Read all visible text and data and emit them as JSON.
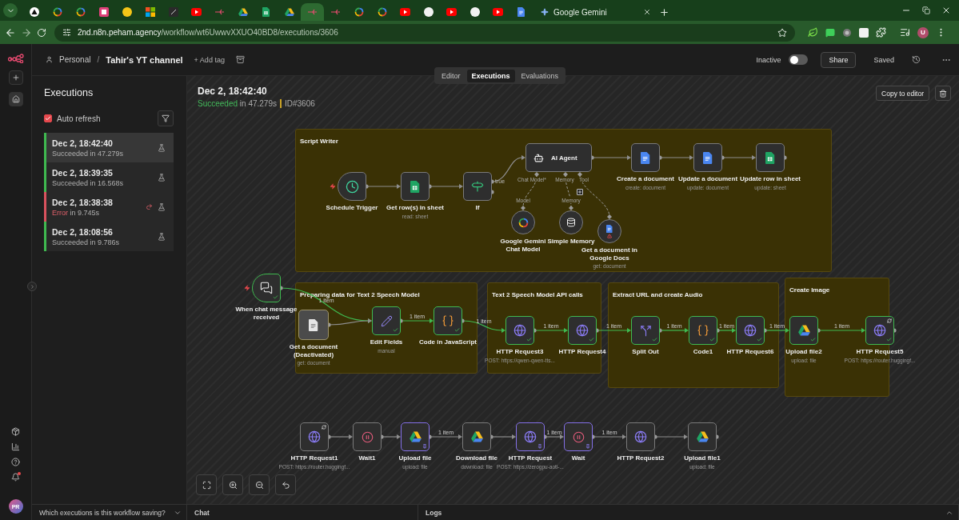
{
  "browser": {
    "tabs": [
      {
        "selected": false
      },
      {
        "selected": false
      },
      {
        "selected": false
      },
      {
        "selected": false
      },
      {
        "selected": false
      },
      {
        "selected": false
      },
      {
        "selected": false
      },
      {
        "selected": false
      },
      {
        "selected": false
      },
      {
        "selected": false
      },
      {
        "selected": false
      },
      {
        "selected": false
      },
      {
        "selected": true
      },
      {
        "selected": false
      },
      {
        "selected": false
      },
      {
        "selected": false
      },
      {
        "selected": false
      },
      {
        "selected": false
      },
      {
        "selected": false
      },
      {
        "selected": false
      },
      {
        "selected": false
      },
      {
        "selected": false
      },
      {
        "label": "Google Gemini",
        "selected": false
      }
    ],
    "url_host": "2nd.n8n.peham.agency",
    "url_path": "/workflow/wt6UwwvXXUO40BD8/executions/3606",
    "profile_initial": "U"
  },
  "rail": {
    "avatar_initials": "PR"
  },
  "header": {
    "project": "Personal",
    "separator": "/",
    "workflow": "Tahir's YT channel",
    "add_tag": "+ Add tag",
    "active_label": "Inactive",
    "active": false,
    "share": "Share",
    "save_status": "Saved"
  },
  "view_tabs": [
    {
      "label": "Editor",
      "selected": false
    },
    {
      "label": "Executions",
      "selected": true
    },
    {
      "label": "Evaluations",
      "selected": false
    }
  ],
  "executions": {
    "title": "Executions",
    "auto_refresh": {
      "label": "Auto refresh",
      "checked": true
    },
    "items": [
      {
        "time": "Dec 2, 18:42:40",
        "status": "Succeeded",
        "kind": "success",
        "duration": "in 47.279s",
        "selected": true
      },
      {
        "time": "Dec 2, 18:39:35",
        "status": "Succeeded",
        "kind": "success",
        "duration": "in 16.568s",
        "selected": false
      },
      {
        "time": "Dec 2, 18:38:38",
        "status": "Error",
        "kind": "error",
        "duration": "in 9.745s",
        "selected": false
      },
      {
        "time": "Dec 2, 18:08:56",
        "status": "Succeeded",
        "kind": "success",
        "duration": "in 9.786s",
        "selected": false
      }
    ]
  },
  "detail": {
    "time": "Dec 2, 18:42:40",
    "status": "Succeeded",
    "kind": "success",
    "duration": "in 47.279s",
    "id": "ID#3606",
    "copy_button": "Copy to editor"
  },
  "canvas": {
    "groups": [
      {
        "title": "Script Writer"
      },
      {
        "title": "Preparing data for Text 2 Speech Model"
      },
      {
        "title": "Text 2 Speech Model API calls"
      },
      {
        "title": "Extract URL and create Audio"
      },
      {
        "title": "Create Image"
      }
    ],
    "nodes": [
      {
        "kind": "schedule",
        "label": "Schedule Trigger",
        "executed": false,
        "pinned": false,
        "disabled": false,
        "retry": false
      },
      {
        "kind": "sheets",
        "label": "Get row(s) in sheet",
        "subtitle": "read: sheet",
        "executed": false,
        "pinned": false,
        "disabled": false,
        "retry": false
      },
      {
        "kind": "if",
        "label": "If",
        "branch_label": "true",
        "executed": false,
        "pinned": false,
        "disabled": false,
        "retry": false
      },
      {
        "kind": "agent",
        "label": "AI Agent",
        "ports": [
          "Chat Model*",
          "Memory",
          "Tool"
        ],
        "executed": false,
        "pinned": false,
        "disabled": false,
        "retry": false
      },
      {
        "kind": "docs",
        "label": "Create a document",
        "subtitle": "create: document",
        "executed": false,
        "pinned": false,
        "disabled": false,
        "retry": false
      },
      {
        "kind": "docs",
        "label": "Update a document",
        "subtitle": "update: document",
        "executed": false,
        "pinned": false,
        "disabled": false,
        "retry": false
      },
      {
        "kind": "sheets",
        "label": "Update row in sheet",
        "subtitle": "update: sheet",
        "executed": false,
        "pinned": false,
        "disabled": false,
        "retry": false
      },
      {
        "kind": "gemini",
        "label": "Google Gemini Chat Model",
        "port": "Model",
        "executed": false,
        "pinned": false,
        "disabled": false,
        "retry": false
      },
      {
        "kind": "memory",
        "label": "Simple Memory",
        "port": "Memory",
        "executed": false,
        "pinned": false,
        "disabled": false,
        "retry": false
      },
      {
        "kind": "tool",
        "label": "Get a document in Google Docs",
        "subtitle": "get: document",
        "executed": false,
        "pinned": false,
        "disabled": false,
        "retry": false
      },
      {
        "kind": "chat",
        "label": "When chat message received",
        "output_label": "1 item",
        "executed": true,
        "pinned": false,
        "disabled": false,
        "retry": false
      },
      {
        "kind": "docs",
        "label": "Get a document (Deactivated)",
        "subtitle": "get: document",
        "executed": false,
        "pinned": false,
        "disabled": true,
        "retry": false
      },
      {
        "kind": "edit",
        "label": "Edit Fields",
        "subtitle": "manual",
        "output_label": "1 item",
        "executed": true,
        "pinned": false,
        "disabled": false,
        "retry": false
      },
      {
        "kind": "code",
        "label": "Code in JavaScript",
        "output_label": "1 item",
        "executed": true,
        "pinned": false,
        "disabled": false,
        "retry": false
      },
      {
        "kind": "http",
        "label": "HTTP Request3",
        "subtitle": "POST: https://qwen-qwen-tts...",
        "output_label": "1 item",
        "executed": true,
        "pinned": false,
        "disabled": false,
        "retry": false
      },
      {
        "kind": "http",
        "label": "HTTP Request4",
        "output_label": "1 item",
        "executed": true,
        "pinned": false,
        "disabled": false,
        "retry": false
      },
      {
        "kind": "split",
        "label": "Split Out",
        "output_label": "1 item",
        "executed": true,
        "pinned": false,
        "disabled": false,
        "retry": false
      },
      {
        "kind": "code",
        "label": "Code1",
        "output_label": "1 item",
        "executed": true,
        "pinned": false,
        "disabled": false,
        "retry": false
      },
      {
        "kind": "http",
        "label": "HTTP Request6",
        "output_label": "1 item",
        "executed": true,
        "pinned": false,
        "disabled": false,
        "retry": false
      },
      {
        "kind": "drive",
        "label": "Upload file2",
        "subtitle": "upload: file",
        "output_label": "1 item",
        "executed": true,
        "pinned": false,
        "disabled": false,
        "retry": false
      },
      {
        "kind": "http",
        "label": "HTTP Request5",
        "subtitle": "POST: https://router.huggingf...",
        "executed": true,
        "pinned": false,
        "disabled": false,
        "retry": true
      },
      {
        "kind": "http",
        "label": "HTTP Request1",
        "subtitle": "POST: https://router.huggingf...",
        "executed": false,
        "pinned": false,
        "disabled": false,
        "retry": true
      },
      {
        "kind": "wait",
        "label": "Wait1",
        "executed": false,
        "pinned": false,
        "disabled": false,
        "retry": false
      },
      {
        "kind": "drive",
        "label": "Upload file",
        "subtitle": "upload: file",
        "output_label": "1 item",
        "executed": false,
        "pinned": true,
        "disabled": false,
        "retry": false
      },
      {
        "kind": "drive",
        "label": "Download file",
        "subtitle": "download: file",
        "executed": false,
        "pinned": false,
        "disabled": false,
        "retry": false
      },
      {
        "kind": "http",
        "label": "HTTP Request",
        "subtitle": "POST: https://zerogpu-aoti-...",
        "output_label": "1 item",
        "executed": false,
        "pinned": true,
        "disabled": false,
        "retry": false
      },
      {
        "kind": "wait",
        "label": "Wait",
        "output_label": "1 item",
        "executed": false,
        "pinned": true,
        "disabled": false,
        "retry": false
      },
      {
        "kind": "http",
        "label": "HTTP Request2",
        "executed": false,
        "pinned": false,
        "disabled": false,
        "retry": false
      },
      {
        "kind": "drive",
        "label": "Upload file1",
        "subtitle": "upload: file",
        "executed": false,
        "pinned": false,
        "disabled": false,
        "retry": false
      }
    ]
  },
  "bottom_bar": {
    "saving_question": "Which executions is this workflow saving?",
    "chat": "Chat",
    "logs": "Logs"
  }
}
